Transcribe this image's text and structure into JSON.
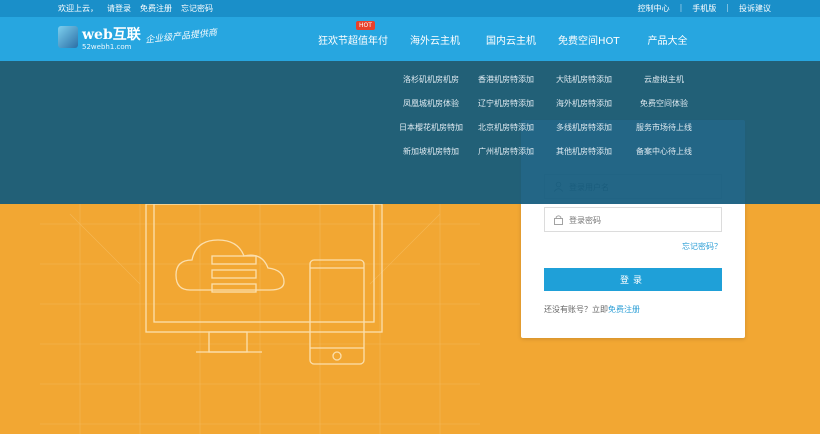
{
  "topbar": {
    "welcome": "欢迎上云，",
    "login": "请登录",
    "register": "免费注册",
    "forgot": "忘记密码",
    "control_panel": "控制中心",
    "sep": "|",
    "mobile": "手机版",
    "complaint": "投诉建议"
  },
  "header": {
    "logo_name": "web互联",
    "logo_domain": "52webh1.com",
    "slogan": "企业级产品提供商"
  },
  "nav": {
    "items": [
      "狂欢节超值年付",
      "海外云主机",
      "国内云主机",
      "免费空间HOT",
      "产品大全"
    ],
    "hot_badge": "HOT"
  },
  "dropdown": {
    "items": [
      "洛杉矶机房机房",
      "香港机房特添加",
      "大陆机房特添加",
      "云虚拟主机",
      "凤凰城机房体验",
      "辽宁机房特添加",
      "海外机房特添加",
      "免费空间体验",
      "日本樱花机房特加",
      "北京机房特添加",
      "多线机房特添加",
      "服务市场待上线",
      "新加坡机房特加",
      "广州机房特添加",
      "其他机房特添加",
      "备案中心待上线"
    ]
  },
  "login": {
    "username_placeholder": "登录用户名",
    "password_placeholder": "登录密码",
    "forgot": "忘记密码？",
    "button": "登录",
    "no_account": "还没有账号？立即",
    "register_link": "免费注册"
  },
  "colors": {
    "topbar": "#1a8fc9",
    "header": "#27a6e0",
    "dropdown": "#125a7d",
    "hero": "#f2a733",
    "accent": "#1fa0d8"
  }
}
